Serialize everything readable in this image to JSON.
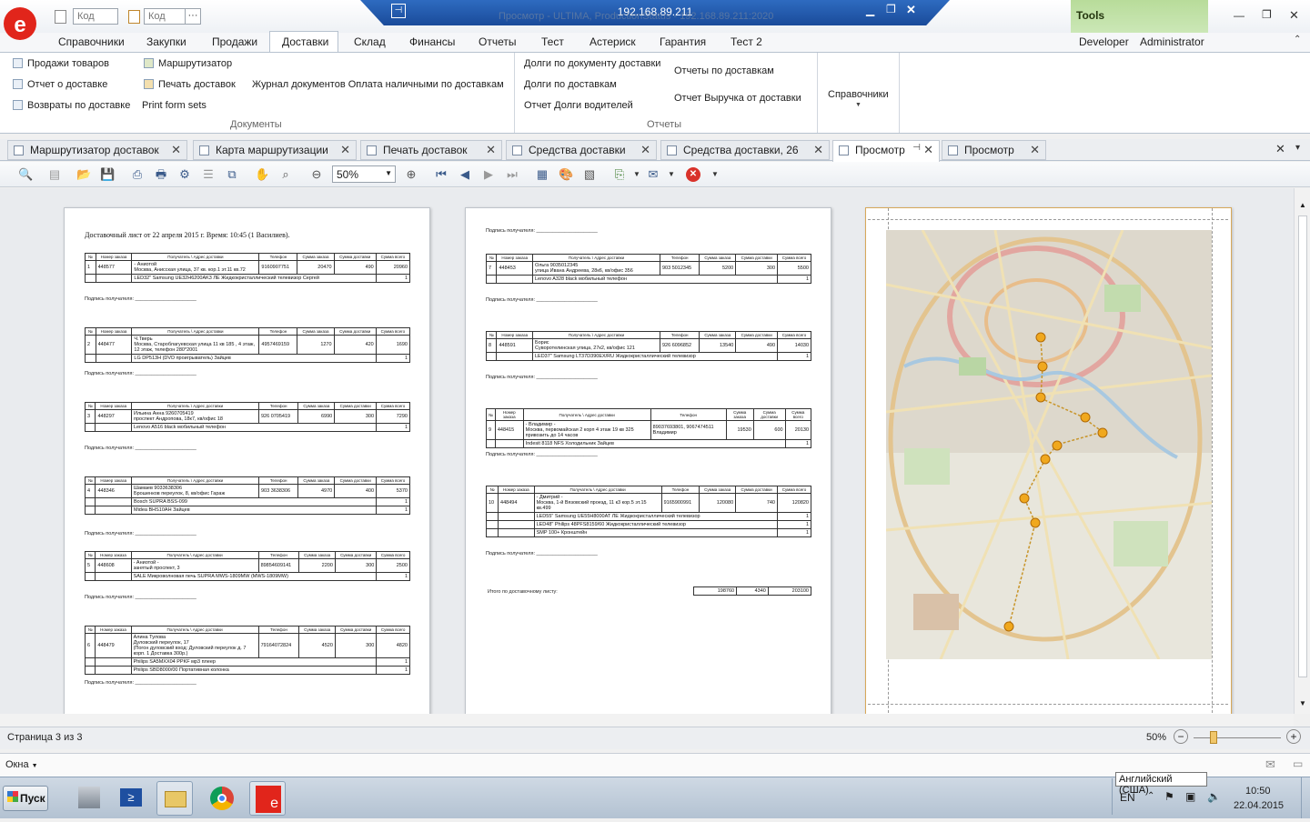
{
  "titlebar": {
    "remote_ip": "192.168.89.211",
    "app_title": "Просмотр - ULTIMA, ProductionStatus - 192.168.89.211:2020",
    "code_placeholder_1": "Код",
    "code_placeholder_2": "Код",
    "more_label": "···"
  },
  "tools_tab": {
    "title": "Tools",
    "developer": "Developer",
    "administrator": "Administrator"
  },
  "menu": [
    "Справочники",
    "Закупки",
    "Продажи",
    "Доставки",
    "Склад",
    "Финансы",
    "Отчеты",
    "Тест",
    "Астериск",
    "Гарантия",
    "Тест 2"
  ],
  "ribbon": {
    "col1": [
      "Продажи товаров",
      "Отчет о доставке",
      "Возвраты по доставке"
    ],
    "col2": [
      "Маршрутизатор",
      "Печать доставок",
      "Print form sets"
    ],
    "journal": "Журнал документов Оплата наличными по доставкам",
    "group_documents": "Документы",
    "col3": [
      "Долги по документу доставки",
      "Долги по доставкам",
      "Отчет Долги водителей"
    ],
    "col4": [
      "Отчеты по доставкам",
      "Отчет Выручка от доставки"
    ],
    "group_reports": "Отчеты",
    "directories": "Справочники"
  },
  "doc_tabs": [
    "Маршрутизатор доставок",
    "Карта маршрутизации",
    "Печать доставок",
    "Средства доставки",
    "Средства доставки, 26",
    "Просмотр",
    "Просмотр"
  ],
  "toolbar": {
    "zoom": "50%"
  },
  "page1": {
    "title": "Доставочный лист от 22 апреля 2015 г. Время: 10:45 (1 Василиев).",
    "headers": [
      "№",
      "Номер заказа",
      "Получатель \\ Адрес доставки",
      "Телефон",
      "Сумма заказа",
      "Сумма доставки",
      "Сумма всего"
    ],
    "sign": "Подпись получателя: ______________________",
    "orders": [
      {
        "n": "1",
        "num": "448577",
        "addr": "- Аниотой\nМосква, Анисская улица, 37 кв. кор.1 эт.11 кв.72",
        "phone": "9160907751",
        "sum": "20470",
        "del": "490",
        "total": "20960",
        "items": [
          "LED32\" Samsung UE32H6200AK3 ЛЕ Жидкокристаллический телевизор Сергей"
        ]
      },
      {
        "n": "2",
        "num": "448477",
        "addr": "Ч.Тверь\nМосква, Староблагуевская улица 11 кв 185 , 4 этаж, 12 этаж, телефон 280*2001",
        "phone": "4957469159",
        "sum": "1270",
        "del": "420",
        "total": "1690",
        "items": [
          "LG DP513H (DVD проигрыватель) Зайцев"
        ]
      },
      {
        "n": "3",
        "num": "448297",
        "addr": "Ильина Анна 9260705419\nпроспект Андропова, 18к7, кв/офис 18",
        "phone": "926 0705419",
        "sum": "6990",
        "del": "300",
        "total": "7290",
        "items": [
          "Lenovo A516 black мобильный телефон"
        ]
      },
      {
        "n": "4",
        "num": "448346",
        "addr": "Шамаев 9033638306\nБрошенков переулок, 8, кв/офис Гараж",
        "phone": "903 3638306",
        "sum": "4970",
        "del": "400",
        "total": "5370",
        "items": [
          "Bosch SUPRA BSS-099",
          "Midea BHS10AH Зайцев"
        ]
      },
      {
        "n": "5",
        "num": "448608",
        "addr": "- Аниотой -\nзанятый проспект, 3",
        "phone": "89854609141",
        "sum": "2200",
        "del": "300",
        "total": "2500",
        "items": [
          "SALE Микроволновая печь SUPRA MWS-1809MW (MWS-1809MW)"
        ]
      },
      {
        "n": "6",
        "num": "448479",
        "addr": "Алина Тулова\nДуловский переулок, 17\n(Погон дуловский вход: Дуловский переулок д. 7 корп. 1 Доставка 300р.)",
        "phone": "79164072824",
        "sum": "4520",
        "del": "300",
        "total": "4820",
        "items": [
          "Philips SA5MXX04 PPKF мр3 плеер",
          "Philips SBD8000/00 Портативная колонка"
        ]
      }
    ]
  },
  "page2": {
    "sign": "Подпись получателя: ______________________",
    "orders": [
      {
        "n": "7",
        "num": "448453",
        "addr": "Ольга 9035012345\nулица Ивана Андреева, 28к6, кв/офис 356",
        "phone": "903 5012345",
        "sum": "5200",
        "del": "300",
        "total": "5500",
        "items": [
          "Lenovo A328 black мобильный телефон"
        ]
      },
      {
        "n": "8",
        "num": "448591",
        "addr": "Борис\nСуворотелинская улица, 27к2, кв/офис 121",
        "phone": "926 6096852",
        "sum": "13540",
        "del": "490",
        "total": "14030",
        "items": [
          "LED37\" Samsung LT37D390EX/RU Жидкокристаллический телевизор"
        ]
      },
      {
        "n": "9",
        "num": "448415",
        "addr": "- Владимир -\nМосква, первомайская 2 корп 4 этаж 19 кв 325 привозить до 14 часов",
        "phone": "89037693801, 9067474511 Владимир",
        "sum": "19530",
        "del": "600",
        "total": "20130",
        "items": [
          "Indesit 8118 NFS Холодильник Зайцев"
        ]
      },
      {
        "n": "10",
        "num": "448494",
        "addr": "- Дмитрий -\nМосква, 1-й Вязовский проезд, 11 к3 кор.5 эт.15 кв.499",
        "phone": "9165900991",
        "sum": "120080",
        "del": "740",
        "total": "120820",
        "items": [
          "LED55\" Samsung UE55H8000AT ЛЕ Жидкокристаллический телевизор",
          "LED48\" Philips 48PFS8159/60 Жидкокристаллический телевизор",
          "SMP 100+ Кронштейн"
        ]
      }
    ],
    "total_label": "Итого по доставочному листу:",
    "total_sum": "198760",
    "total_del": "4340",
    "total_all": "203100"
  },
  "status": {
    "page": "Страница 3 из 3",
    "zoom": "50%"
  },
  "windows_label": "Окна",
  "taskbar": {
    "start": "Пуск",
    "lang": "EN",
    "tooltip": "Английский (США)",
    "time": "10:50",
    "date": "22.04.2015"
  },
  "colors": {
    "brand": "#e1251b",
    "remote": "#1f56a8",
    "tools": "#c7e5ae"
  }
}
